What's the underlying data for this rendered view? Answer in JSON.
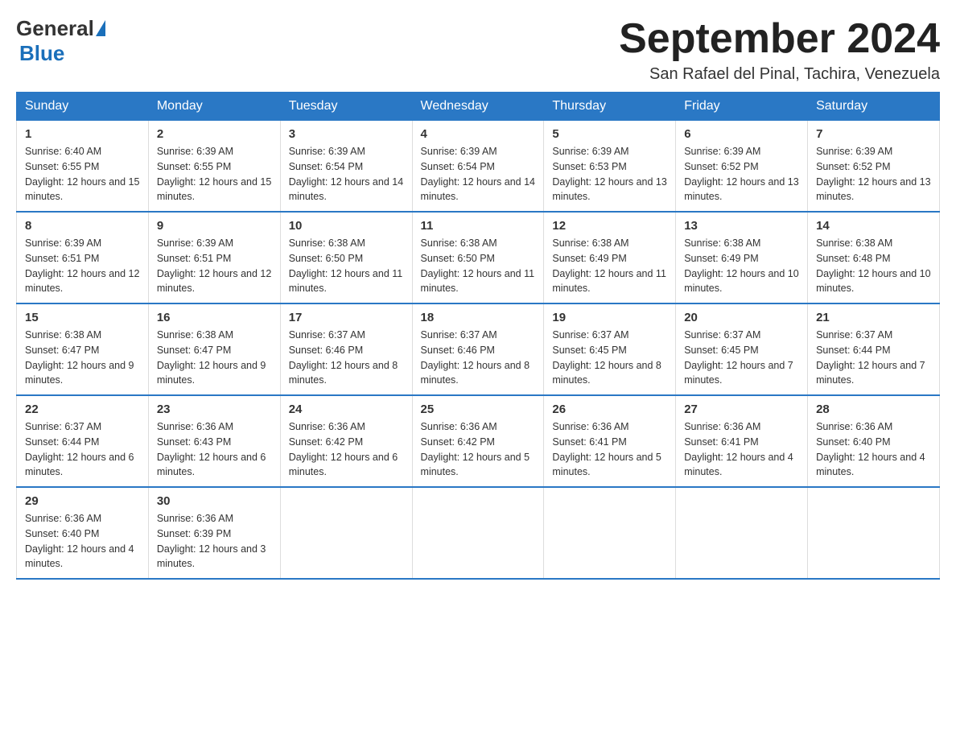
{
  "logo": {
    "general": "General",
    "blue": "Blue"
  },
  "title": "September 2024",
  "location": "San Rafael del Pinal, Tachira, Venezuela",
  "days_of_week": [
    "Sunday",
    "Monday",
    "Tuesday",
    "Wednesday",
    "Thursday",
    "Friday",
    "Saturday"
  ],
  "weeks": [
    [
      {
        "day": "1",
        "sunrise": "6:40 AM",
        "sunset": "6:55 PM",
        "daylight": "12 hours and 15 minutes."
      },
      {
        "day": "2",
        "sunrise": "6:39 AM",
        "sunset": "6:55 PM",
        "daylight": "12 hours and 15 minutes."
      },
      {
        "day": "3",
        "sunrise": "6:39 AM",
        "sunset": "6:54 PM",
        "daylight": "12 hours and 14 minutes."
      },
      {
        "day": "4",
        "sunrise": "6:39 AM",
        "sunset": "6:54 PM",
        "daylight": "12 hours and 14 minutes."
      },
      {
        "day": "5",
        "sunrise": "6:39 AM",
        "sunset": "6:53 PM",
        "daylight": "12 hours and 13 minutes."
      },
      {
        "day": "6",
        "sunrise": "6:39 AM",
        "sunset": "6:52 PM",
        "daylight": "12 hours and 13 minutes."
      },
      {
        "day": "7",
        "sunrise": "6:39 AM",
        "sunset": "6:52 PM",
        "daylight": "12 hours and 13 minutes."
      }
    ],
    [
      {
        "day": "8",
        "sunrise": "6:39 AM",
        "sunset": "6:51 PM",
        "daylight": "12 hours and 12 minutes."
      },
      {
        "day": "9",
        "sunrise": "6:39 AM",
        "sunset": "6:51 PM",
        "daylight": "12 hours and 12 minutes."
      },
      {
        "day": "10",
        "sunrise": "6:38 AM",
        "sunset": "6:50 PM",
        "daylight": "12 hours and 11 minutes."
      },
      {
        "day": "11",
        "sunrise": "6:38 AM",
        "sunset": "6:50 PM",
        "daylight": "12 hours and 11 minutes."
      },
      {
        "day": "12",
        "sunrise": "6:38 AM",
        "sunset": "6:49 PM",
        "daylight": "12 hours and 11 minutes."
      },
      {
        "day": "13",
        "sunrise": "6:38 AM",
        "sunset": "6:49 PM",
        "daylight": "12 hours and 10 minutes."
      },
      {
        "day": "14",
        "sunrise": "6:38 AM",
        "sunset": "6:48 PM",
        "daylight": "12 hours and 10 minutes."
      }
    ],
    [
      {
        "day": "15",
        "sunrise": "6:38 AM",
        "sunset": "6:47 PM",
        "daylight": "12 hours and 9 minutes."
      },
      {
        "day": "16",
        "sunrise": "6:38 AM",
        "sunset": "6:47 PM",
        "daylight": "12 hours and 9 minutes."
      },
      {
        "day": "17",
        "sunrise": "6:37 AM",
        "sunset": "6:46 PM",
        "daylight": "12 hours and 8 minutes."
      },
      {
        "day": "18",
        "sunrise": "6:37 AM",
        "sunset": "6:46 PM",
        "daylight": "12 hours and 8 minutes."
      },
      {
        "day": "19",
        "sunrise": "6:37 AM",
        "sunset": "6:45 PM",
        "daylight": "12 hours and 8 minutes."
      },
      {
        "day": "20",
        "sunrise": "6:37 AM",
        "sunset": "6:45 PM",
        "daylight": "12 hours and 7 minutes."
      },
      {
        "day": "21",
        "sunrise": "6:37 AM",
        "sunset": "6:44 PM",
        "daylight": "12 hours and 7 minutes."
      }
    ],
    [
      {
        "day": "22",
        "sunrise": "6:37 AM",
        "sunset": "6:44 PM",
        "daylight": "12 hours and 6 minutes."
      },
      {
        "day": "23",
        "sunrise": "6:36 AM",
        "sunset": "6:43 PM",
        "daylight": "12 hours and 6 minutes."
      },
      {
        "day": "24",
        "sunrise": "6:36 AM",
        "sunset": "6:42 PM",
        "daylight": "12 hours and 6 minutes."
      },
      {
        "day": "25",
        "sunrise": "6:36 AM",
        "sunset": "6:42 PM",
        "daylight": "12 hours and 5 minutes."
      },
      {
        "day": "26",
        "sunrise": "6:36 AM",
        "sunset": "6:41 PM",
        "daylight": "12 hours and 5 minutes."
      },
      {
        "day": "27",
        "sunrise": "6:36 AM",
        "sunset": "6:41 PM",
        "daylight": "12 hours and 4 minutes."
      },
      {
        "day": "28",
        "sunrise": "6:36 AM",
        "sunset": "6:40 PM",
        "daylight": "12 hours and 4 minutes."
      }
    ],
    [
      {
        "day": "29",
        "sunrise": "6:36 AM",
        "sunset": "6:40 PM",
        "daylight": "12 hours and 4 minutes."
      },
      {
        "day": "30",
        "sunrise": "6:36 AM",
        "sunset": "6:39 PM",
        "daylight": "12 hours and 3 minutes."
      },
      null,
      null,
      null,
      null,
      null
    ]
  ]
}
